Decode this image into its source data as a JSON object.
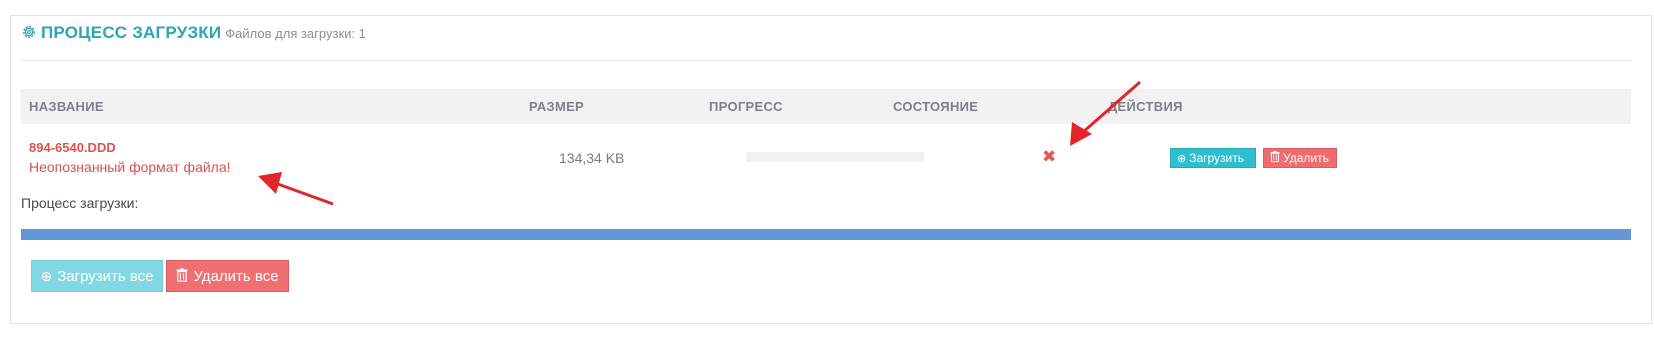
{
  "header": {
    "icon": "gear-icon",
    "title": "ПРОЦЕСС ЗАГРУЗКИ",
    "subtitle": "Файлов для загрузки: 1"
  },
  "table": {
    "columns": [
      "НАЗВАНИЕ",
      "РАЗМЕР",
      "ПРОГРЕСС",
      "СОСТОЯНИЕ",
      "ДЕЙСТВИЯ"
    ],
    "rows": [
      {
        "name": "894-6540.DDD",
        "error": "Неопознанный формат файла!",
        "size": "134,34 KB",
        "progress": 0,
        "status_icon": "close-icon",
        "status_glyph": "✖",
        "actions": {
          "upload_label": "Загрузить",
          "upload_icon": "upload-circle-icon",
          "delete_label": "Удалить",
          "delete_icon": "trash-icon"
        }
      }
    ]
  },
  "queue": {
    "label": "Процесс загрузки:",
    "total_progress": 100
  },
  "footer": {
    "upload_all_label": "Загрузить все",
    "delete_all_label": "Удалить все"
  },
  "colors": {
    "accent": "#2fa4b8",
    "error": "#d9534f",
    "upload_btn": "#2dbfcf",
    "delete_btn": "#ee6b6e",
    "progress": "#6497d8",
    "annotation_arrow": "#e3242b"
  },
  "icons": {
    "upload_glyph": "⊕",
    "trash_glyph": "🗑"
  }
}
